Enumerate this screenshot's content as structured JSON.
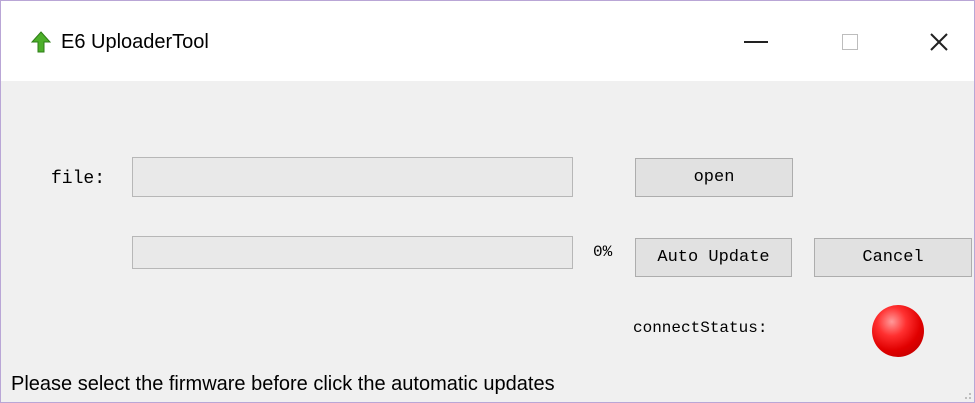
{
  "window": {
    "title": "E6 UploaderTool",
    "controls": {
      "minimize": "minimize",
      "maximize": "maximize",
      "close": "close"
    }
  },
  "form": {
    "file_label": "file:",
    "file_value": "",
    "progress_percent": 0,
    "progress_label": "0%",
    "open_button": "open",
    "auto_update_button": "Auto Update",
    "cancel_button": "Cancel",
    "connect_status_label": "connectStatus:",
    "connect_status_color": "#e00000"
  },
  "status_bar": {
    "message": "Please select the firmware before click the automatic updates"
  },
  "icons": {
    "app": "green-up-arrow-icon",
    "minimize": "minimize-icon",
    "maximize": "maximize-icon",
    "close": "close-icon",
    "status_led": "red-status-led"
  },
  "colors": {
    "window_border": "#b9a6d6",
    "window_bg": "#f0f0f0",
    "app_icon": "#4caf2a",
    "status_led": "#e00000"
  }
}
